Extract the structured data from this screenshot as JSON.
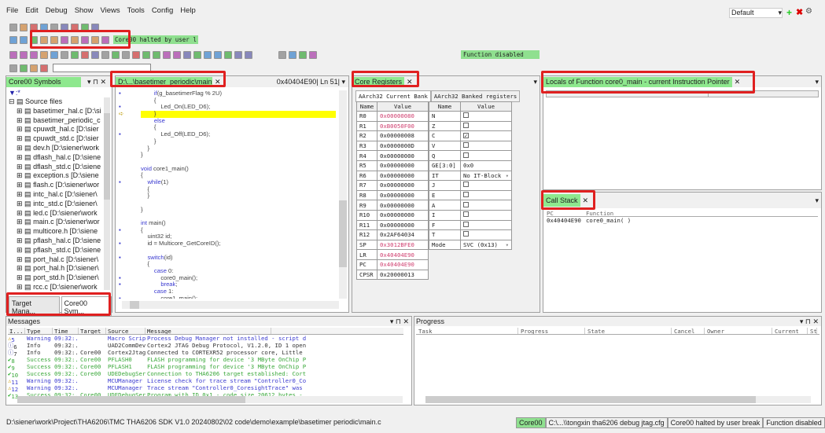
{
  "menu": [
    "File",
    "Edit",
    "Debug",
    "Show",
    "Views",
    "Tools",
    "Config",
    "Help"
  ],
  "layout_select": "Default",
  "toolbar": {
    "row1_icons": [
      "new-file-icon",
      "open-icon",
      "open-workspace-icon",
      "save-workspace-icon",
      "save-icon",
      "save-all-icon",
      "cut-icon",
      "copy-icon",
      "paste-icon"
    ],
    "row2_icons": [
      "run-icon",
      "go-icon",
      "step-into-icon",
      "step-over-icon",
      "step-out-icon",
      "step-back-icon",
      "return-icon",
      "animate-icon",
      "stop-icon",
      "reset-icon"
    ],
    "core_status": "Core00 halted by user l",
    "row3_icons": [
      "program-icon",
      "memory-icon",
      "watch-icon",
      "registers-icon",
      "locals-icon",
      "breakpoint-icon",
      "trace-icon",
      "hourglass-icon",
      "flash-icon",
      "window-icon",
      "terminal-icon",
      "more-icon",
      "flag-icon",
      "chart-icon",
      "sync-icon",
      "config-icon",
      "cross-icon",
      "ide-icon",
      "monitor-icon",
      "globe-icon",
      "grid-icon",
      "tile-icon",
      "table-icon",
      "list-icon"
    ],
    "row3b_icons": [
      "bookmark-icon",
      "bookmark2-icon",
      "bookmark3-icon",
      "find-icon"
    ],
    "function_status": "Function disabled",
    "row4_icons": [
      "trace-on-icon",
      "trace-step-icon",
      "stop-trace-icon",
      "filter-icon"
    ]
  },
  "symbols": {
    "title": "Core00 Symbols",
    "filter": "*",
    "root": "Source files",
    "items": [
      "basetimer_hal.c [D:\\si",
      "basetimer_periodic_c",
      "cpuwdt_hal.c [D:\\sier",
      "cpuwdt_std.c [D:\\sier",
      "dev.h [D:\\siener\\work",
      "dflash_hal.c [D:\\siene",
      "dflash_std.c [D:\\siene",
      "exception.s [D:\\siene",
      "flash.c [D:\\siener\\wor",
      "intc_hal.c [D:\\siener\\",
      "intc_std.c [D:\\siener\\",
      "led.c [D:\\siener\\work",
      "main.c [D:\\siener\\wor",
      "multicore.h [D:\\siene",
      "pflash_hal.c [D:\\siene",
      "pflash_std.c [D:\\siene",
      "port_hal.c [D:\\siener\\",
      "port_hal.h [D:\\siener\\",
      "port_std.h [D:\\siener\\",
      "rcc.c [D:\\siener\\work"
    ],
    "tabs": [
      "Target Mana...",
      "Core00 Sym..."
    ]
  },
  "editor": {
    "tab": "D:\\...\\basetimer_periodic\\main.c",
    "address": "0x40404E90",
    "line": "Ln 51",
    "lines": [
      {
        "t": "        if(g_basetimerFlag % 2U)",
        "bp": true
      },
      {
        "t": "        {"
      },
      {
        "t": "            Led_On(LED_D6);",
        "bp": true
      },
      {
        "t": "        }",
        "cur": true
      },
      {
        "t": "        else"
      },
      {
        "t": "        {"
      },
      {
        "t": "            Led_Off(LED_D6);",
        "bp": true
      },
      {
        "t": "        }"
      },
      {
        "t": "    }"
      },
      {
        "t": "}"
      },
      {
        "t": ""
      },
      {
        "t": "void core1_main()"
      },
      {
        "t": "{"
      },
      {
        "t": "    while(1)",
        "bp": true
      },
      {
        "t": "    {"
      },
      {
        "t": "    }"
      },
      {
        "t": ""
      },
      {
        "t": "}"
      },
      {
        "t": ""
      },
      {
        "t": "int main()"
      },
      {
        "t": "{",
        "bp": true
      },
      {
        "t": "    uint32 id;"
      },
      {
        "t": "    id = Multicore_GetCoreID();",
        "bp": true
      },
      {
        "t": ""
      },
      {
        "t": "    switch(id)",
        "bp": true
      },
      {
        "t": "    {"
      },
      {
        "t": "        case 0:"
      },
      {
        "t": "            core0_main();",
        "bp": true
      },
      {
        "t": "            break;",
        "bp": true
      },
      {
        "t": "        case 1:"
      },
      {
        "t": "            core1_main();",
        "bp": true
      }
    ]
  },
  "registers": {
    "title": "Core Registers",
    "tabs": [
      "AArch32 Current Bank",
      "AArch32 Banked registers"
    ],
    "headers": [
      "Name",
      "Value",
      "Name",
      "Value"
    ],
    "core": [
      [
        "R0",
        "0x00000080",
        true
      ],
      [
        "R1",
        "0xB0050F00",
        true
      ],
      [
        "R2",
        "0x00000008",
        false
      ],
      [
        "R3",
        "0x0000000D",
        false
      ],
      [
        "R4",
        "0x00000000",
        false
      ],
      [
        "R5",
        "0x00000000",
        false
      ],
      [
        "R6",
        "0x00000000",
        false
      ],
      [
        "R7",
        "0x00000000",
        false
      ],
      [
        "R8",
        "0x00000000",
        false
      ],
      [
        "R9",
        "0x00000000",
        false
      ],
      [
        "R10",
        "0x00000000",
        false
      ],
      [
        "R11",
        "0x00000000",
        false
      ],
      [
        "R12",
        "0x2AF64034",
        false
      ],
      [
        "SP",
        "0x3012BFE0",
        true
      ],
      [
        "LR",
        "0x40404E90",
        true
      ],
      [
        "PC",
        "0x40404E90",
        true
      ],
      [
        "CPSR",
        "0x20000013",
        false
      ]
    ],
    "flags": [
      [
        "N",
        false
      ],
      [
        "Z",
        false
      ],
      [
        "C",
        true
      ],
      [
        "V",
        false
      ],
      [
        "Q",
        false
      ],
      [
        "GE[3:0]",
        "0x0"
      ],
      [
        "IT",
        "No IT-Block"
      ],
      [
        "J",
        false
      ],
      [
        "E",
        false
      ],
      [
        "A",
        false
      ],
      [
        "I",
        false
      ],
      [
        "F",
        false
      ],
      [
        "T",
        false
      ],
      [
        "Mode",
        "SVC (0x13)"
      ]
    ]
  },
  "locals": {
    "title": "Locals of Function core0_main - current Instruction Pointer"
  },
  "callstack": {
    "title": "Call Stack",
    "headers": [
      "PC",
      "Function"
    ],
    "rows": [
      [
        "0x40404E90",
        "core0_main(  )"
      ]
    ]
  },
  "messages": {
    "title": "Messages",
    "headers": [
      "I...",
      "Type",
      "Time",
      "Target",
      "Source",
      "Message"
    ],
    "rows": [
      [
        "warn",
        "5",
        "Warning",
        "09:32:...",
        "",
        "Macro Script...",
        "Process Debug Manager not installed - script d"
      ],
      [
        "info",
        "6",
        "Info",
        "09:32:...",
        "",
        "UAD2CommDev",
        "Cortex2 JTAG Debug Protocol, V1.2.0, ID 1 open"
      ],
      [
        "info",
        "7",
        "Info",
        "09:32:...",
        "Core00",
        "Cortex2JtagIstf",
        "Connected to CORTEXR52 processor core, Little"
      ],
      [
        "ok",
        "8",
        "Success",
        "09:32:...",
        "Core00",
        "PFLASH0",
        "FLASH programming for device '3 MByte OnChip P"
      ],
      [
        "ok",
        "9",
        "Success",
        "09:32:...",
        "Core00",
        "PFLASH1",
        "FLASH programming for device '3 MByte OnChip P"
      ],
      [
        "ok",
        "10",
        "Success",
        "09:32:...",
        "Core00",
        "UDEDebugServer",
        "Connection to THA6206 target established: Cort"
      ],
      [
        "warn",
        "11",
        "Warning",
        "09:32:...",
        "",
        "MCUManager",
        "License check for trace stream \"Controller0_Co"
      ],
      [
        "warn",
        "12",
        "Warning",
        "09:32:...",
        "",
        "MCUManager",
        "Trace stream \"Controller0_CoresightTrace\" was"
      ],
      [
        "ok",
        "13",
        "Success",
        "09:32:...",
        "Core00",
        "UDEDebugServer",
        "Program with ID 0x1 - code size 20612 bytes -"
      ]
    ]
  },
  "progress": {
    "title": "Progress",
    "headers": [
      "Task",
      "Progress",
      "State",
      "Cancel",
      "Owner",
      "Current",
      "St"
    ]
  },
  "statusbar": {
    "path": "D:\\siener\\work\\Project\\THA6206\\TMC THA6206 SDK V1.0 20240802\\02 code\\demo\\example\\basetimer periodic\\main.c",
    "core": "Core00",
    "cfg": "C:\\...\\\\tongxin tha6206 debug jtag.cfg",
    "halt": "Core00 halted by user break",
    "func": "Function disabled"
  },
  "colors": {
    "active_tab": "#8ee88e",
    "highlight": "#ffff00",
    "warning": "#3a3ad0",
    "success": "#3aa83a",
    "reg_changed": "#d04070",
    "annotation": "#e02020"
  }
}
